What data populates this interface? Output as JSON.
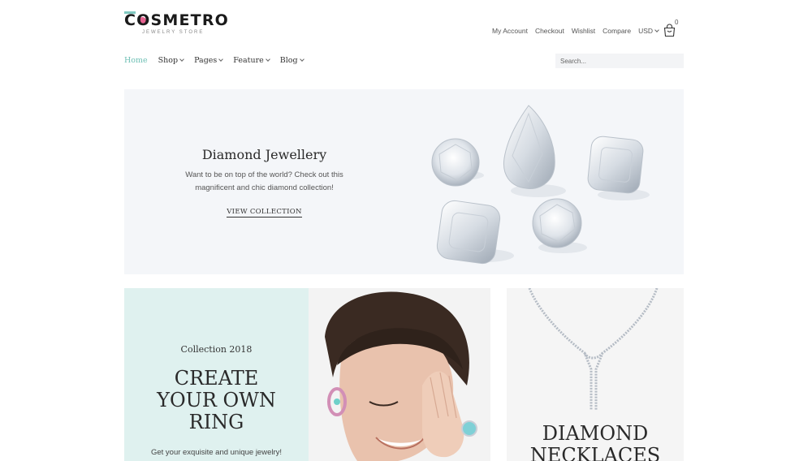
{
  "brand": {
    "logo": "COSMETRO",
    "tagline": "JEWELRY STORE"
  },
  "top_links": {
    "account": "My Account",
    "checkout": "Checkout",
    "wishlist": "Wishlist",
    "compare": "Compare",
    "currency": "USD",
    "cart_count": "0"
  },
  "nav": {
    "items": [
      {
        "label": "Home",
        "active": true,
        "dropdown": false
      },
      {
        "label": "Shop",
        "dropdown": true
      },
      {
        "label": "Pages",
        "dropdown": true
      },
      {
        "label": "Feature",
        "dropdown": true
      },
      {
        "label": "Blog",
        "dropdown": true
      }
    ]
  },
  "search": {
    "placeholder": "Search..."
  },
  "hero": {
    "title": "Diamond Jewellery",
    "text_line1": "Want to be on top of the world? Check out this",
    "text_line2": "magnificent and chic diamond collection!",
    "link": "VIEW COLLECTION"
  },
  "promo": {
    "kicker": "Collection 2018",
    "title_line1": "CREATE",
    "title_line2": "YOUR OWN",
    "title_line3": "RING",
    "subtitle": "Get your exquisite and unique jewelry!"
  },
  "necklaces": {
    "title_line1": "DIAMOND",
    "title_line2": "NECKLACES"
  },
  "colors": {
    "accent": "#6fc0b5",
    "promo_bg": "#dff1ef",
    "hero_bg": "#f4f6f9"
  }
}
